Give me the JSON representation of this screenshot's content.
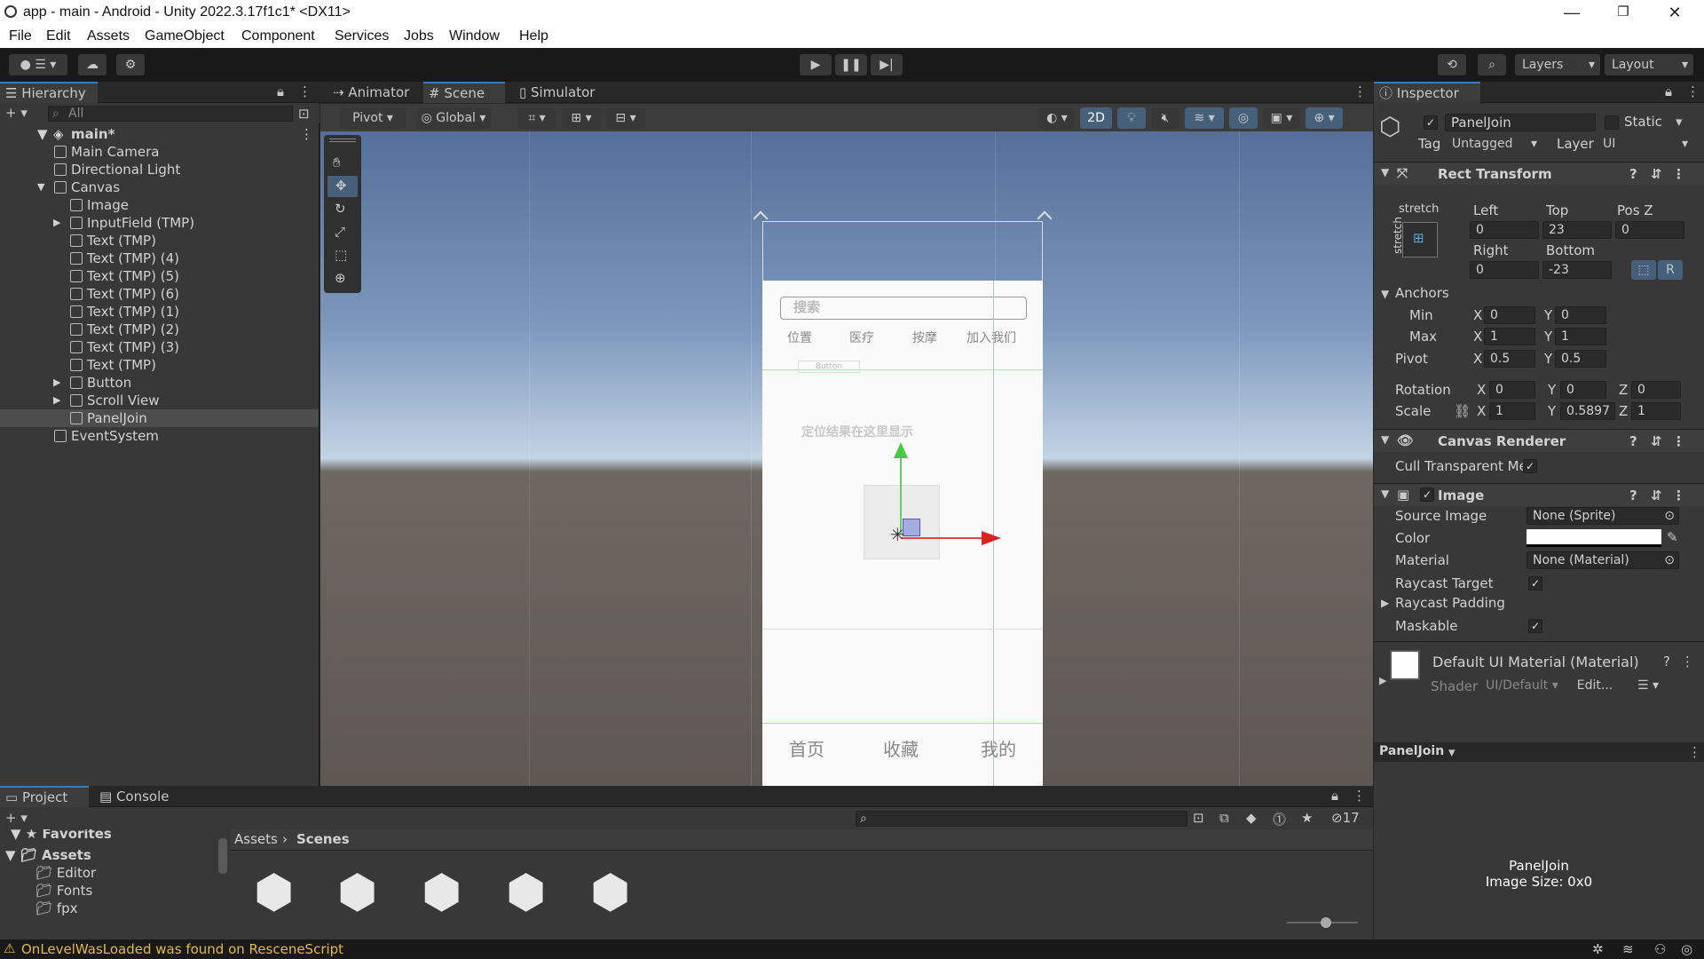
{
  "window": {
    "title": "app - main - Android - Unity 2022.3.17f1c1* <DX11>"
  },
  "menu": [
    "File",
    "Edit",
    "Assets",
    "GameObject",
    "Component",
    "Services",
    "Jobs",
    "Window",
    "Help"
  ],
  "toolbar": {
    "layers": "Layers",
    "layout": "Layout"
  },
  "hierarchy": {
    "tab": "Hierarchy",
    "search_placeholder": "All",
    "scene": "main*",
    "items": [
      {
        "label": "Main Camera",
        "depth": 1,
        "arrow": ""
      },
      {
        "label": "Directional Light",
        "depth": 1,
        "arrow": ""
      },
      {
        "label": "Canvas",
        "depth": 1,
        "arrow": "▼"
      },
      {
        "label": "Image",
        "depth": 2,
        "arrow": ""
      },
      {
        "label": "InputField (TMP)",
        "depth": 2,
        "arrow": "▶"
      },
      {
        "label": "Text (TMP)",
        "depth": 2,
        "arrow": ""
      },
      {
        "label": "Text (TMP) (4)",
        "depth": 2,
        "arrow": ""
      },
      {
        "label": "Text (TMP) (5)",
        "depth": 2,
        "arrow": ""
      },
      {
        "label": "Text (TMP) (6)",
        "depth": 2,
        "arrow": ""
      },
      {
        "label": "Text (TMP) (1)",
        "depth": 2,
        "arrow": ""
      },
      {
        "label": "Text (TMP) (2)",
        "depth": 2,
        "arrow": ""
      },
      {
        "label": "Text (TMP) (3)",
        "depth": 2,
        "arrow": ""
      },
      {
        "label": "Text (TMP)",
        "depth": 2,
        "arrow": ""
      },
      {
        "label": "Button",
        "depth": 2,
        "arrow": "▶"
      },
      {
        "label": "Scroll View",
        "depth": 2,
        "arrow": "▶"
      },
      {
        "label": "PanelJoin",
        "depth": 2,
        "arrow": "",
        "selected": true
      },
      {
        "label": "EventSystem",
        "depth": 1,
        "arrow": ""
      }
    ]
  },
  "scene_tabs": [
    "Animator",
    "Scene",
    "Simulator"
  ],
  "scene_toolbar": {
    "pivot": "Pivot",
    "global": "Global",
    "mode2d": "2D"
  },
  "phone": {
    "search_placeholder": "搜索",
    "nav": [
      "位置",
      "医疗",
      "按摩",
      "加入我们"
    ],
    "button": "Button",
    "location_text": "定位结果在这里显示",
    "bottom_nav": [
      "首页",
      "收藏",
      "我的"
    ]
  },
  "inspector": {
    "tab": "Inspector",
    "object_name": "PanelJoin",
    "static_label": "Static",
    "tag_label": "Tag",
    "tag_value": "Untagged",
    "layer_label": "Layer",
    "layer_value": "UI",
    "rect": {
      "title": "Rect Transform",
      "stretch": "stretch",
      "left_label": "Left",
      "left": "0",
      "top_label": "Top",
      "top": "23",
      "posz_label": "Pos Z",
      "posz": "0",
      "right_label": "Right",
      "right": "0",
      "bottom_label": "Bottom",
      "bottom": "-23",
      "anchors": "Anchors",
      "min": "Min",
      "min_x": "0",
      "min_y": "0",
      "max": "Max",
      "max_x": "1",
      "max_y": "1",
      "pivot": "Pivot",
      "pivot_x": "0.5",
      "pivot_y": "0.5",
      "rotation": "Rotation",
      "rot_x": "0",
      "rot_y": "0",
      "rot_z": "0",
      "scale": "Scale",
      "scale_x": "1",
      "scale_y": "0.5897",
      "scale_z": "1",
      "r_button": "R"
    },
    "canvas_renderer": {
      "title": "Canvas Renderer",
      "cull": "Cull Transparent Me"
    },
    "image": {
      "title": "Image",
      "source_label": "Source Image",
      "source": "None (Sprite)",
      "color_label": "Color",
      "material_label": "Material",
      "material": "None (Material)",
      "raycast_target": "Raycast Target",
      "raycast_padding": "Raycast Padding",
      "maskable": "Maskable"
    },
    "material": {
      "name": "Default UI Material (Material)",
      "shader_label": "Shader",
      "shader": "UI/Default",
      "edit": "Edit..."
    },
    "preview": {
      "name": "PanelJoin",
      "title": "PanelJoin",
      "size": "Image Size: 0x0"
    }
  },
  "bottom": {
    "tabs": [
      "Project",
      "Console"
    ],
    "favorites": "Favorites",
    "assets": "Assets",
    "folders": [
      "Editor",
      "Fonts",
      "fpx"
    ],
    "breadcrumb": [
      "Assets",
      "Scenes"
    ],
    "hidden_count": "17"
  },
  "status": {
    "message": "OnLevelWasLoaded was found on ResceneScript"
  }
}
